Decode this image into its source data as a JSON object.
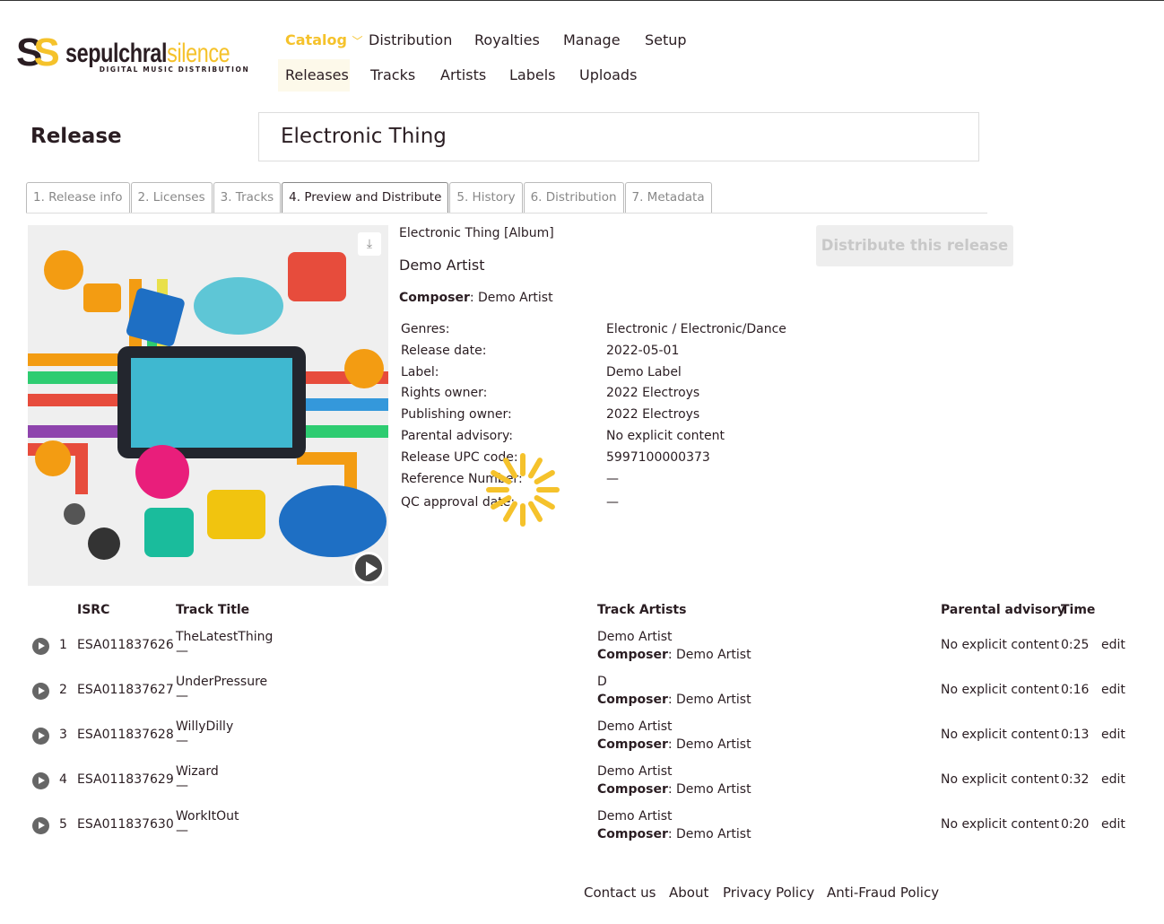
{
  "logo": {
    "part1": "sepulchral",
    "part2": "silence",
    "tagline": "DIGITAL MUSIC DISTRIBUTION"
  },
  "nav": {
    "main": [
      "Catalog",
      "Distribution",
      "Royalties",
      "Manage",
      "Setup"
    ],
    "sub": [
      "Releases",
      "Tracks",
      "Artists",
      "Labels",
      "Uploads"
    ]
  },
  "page": {
    "heading": "Release",
    "title_value": "Electronic Thing"
  },
  "tabs": [
    "1. Release info",
    "2. Licenses",
    "3. Tracks",
    "4. Preview and Distribute",
    "5. History",
    "6. Distribution",
    "7. Metadata"
  ],
  "release": {
    "title": "Electronic Thing [Album]",
    "artist": "Demo Artist",
    "composer_label": "Composer",
    "composer": "Demo Artist",
    "fields": [
      [
        "Genres:",
        "Electronic / Electronic/Dance"
      ],
      [
        "Release date:",
        "2022-05-01"
      ],
      [
        "Label:",
        "Demo Label"
      ],
      [
        "Rights owner:",
        "2022 Electroys"
      ],
      [
        "Publishing owner:",
        "2022 Electroys"
      ],
      [
        "Parental advisory:",
        "No explicit content"
      ],
      [
        "Release UPC code:",
        "5997100000373"
      ],
      [
        "Reference Number:",
        "—"
      ],
      [
        "QC approval date:",
        "—"
      ]
    ]
  },
  "distribute_button": "Distribute this release",
  "colors": {
    "accent": "#f5c22b",
    "text": "#2a1d22"
  },
  "table": {
    "headers": {
      "isrc": "ISRC",
      "title": "Track Title",
      "artists": "Track Artists",
      "parental": "Parental advisory",
      "time": "Time"
    },
    "rows": [
      {
        "n": "1",
        "isrc": "ESA011837626",
        "title": "TheLatestThing",
        "sub": "—",
        "artist": "Demo Artist",
        "composer": "Demo Artist",
        "parental": "No explicit content",
        "time": "0:25",
        "edit": "edit"
      },
      {
        "n": "2",
        "isrc": "ESA011837627",
        "title": "UnderPressure",
        "sub": "—",
        "artist": "D",
        "composer": "Demo Artist",
        "parental": "No explicit content",
        "time": "0:16",
        "edit": "edit"
      },
      {
        "n": "3",
        "isrc": "ESA011837628",
        "title": "WillyDilly",
        "sub": "—",
        "artist": "Demo Artist",
        "composer": "Demo Artist",
        "parental": "No explicit content",
        "time": "0:13",
        "edit": "edit"
      },
      {
        "n": "4",
        "isrc": "ESA011837629",
        "title": "Wizard",
        "sub": "—",
        "artist": "Demo Artist",
        "composer": "Demo Artist",
        "parental": "No explicit content",
        "time": "0:32",
        "edit": "edit"
      },
      {
        "n": "5",
        "isrc": "ESA011837630",
        "title": "WorkItOut",
        "sub": "—",
        "artist": "Demo Artist",
        "composer": "Demo Artist",
        "parental": "No explicit content",
        "time": "0:20",
        "edit": "edit"
      }
    ]
  },
  "footer": [
    "Contact us",
    "About",
    "Privacy Policy",
    "Anti-Fraud Policy"
  ]
}
